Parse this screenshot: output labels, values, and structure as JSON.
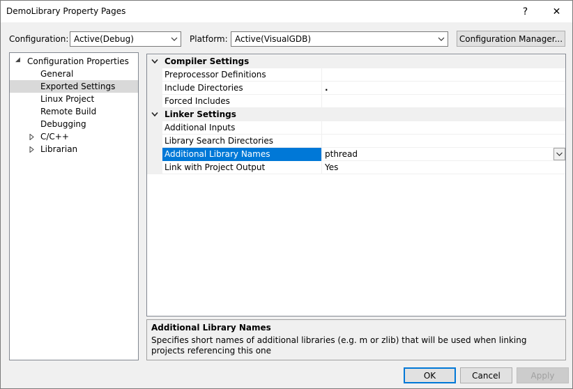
{
  "window": {
    "title": "DemoLibrary Property Pages",
    "help_glyph": "?",
    "close_glyph": "✕"
  },
  "top": {
    "configuration_label": "Configuration:",
    "configuration_value": "Active(Debug)",
    "platform_label": "Platform:",
    "platform_value": "Active(VisualGDB)",
    "config_manager_button": "Configuration Manager..."
  },
  "tree": {
    "root": "Configuration Properties",
    "items": [
      {
        "label": "General"
      },
      {
        "label": "Exported Settings",
        "selected": true
      },
      {
        "label": "Linux Project"
      },
      {
        "label": "Remote Build"
      },
      {
        "label": "Debugging"
      },
      {
        "label": "C/C++",
        "expandable": true
      },
      {
        "label": "Librarian",
        "expandable": true
      }
    ]
  },
  "grid": {
    "categories": [
      {
        "name": "Compiler Settings",
        "rows": [
          {
            "name": "Preprocessor Definitions",
            "value": ""
          },
          {
            "name": "Include Directories",
            "value": "."
          },
          {
            "name": "Forced Includes",
            "value": ""
          }
        ]
      },
      {
        "name": "Linker Settings",
        "rows": [
          {
            "name": "Additional Inputs",
            "value": ""
          },
          {
            "name": "Library Search Directories",
            "value": ""
          },
          {
            "name": "Additional Library Names",
            "value": "pthread",
            "selected": true
          },
          {
            "name": "Link with Project Output",
            "value": "Yes"
          }
        ]
      }
    ]
  },
  "description": {
    "title": "Additional Library Names",
    "text": "Specifies short names of additional libraries (e.g. m or zlib) that will be used when linking projects referencing this one"
  },
  "buttons": {
    "ok": "OK",
    "cancel": "Cancel",
    "apply": "Apply"
  },
  "colors": {
    "selection": "#0078d7",
    "tree_selection": "#d9d9d9"
  }
}
